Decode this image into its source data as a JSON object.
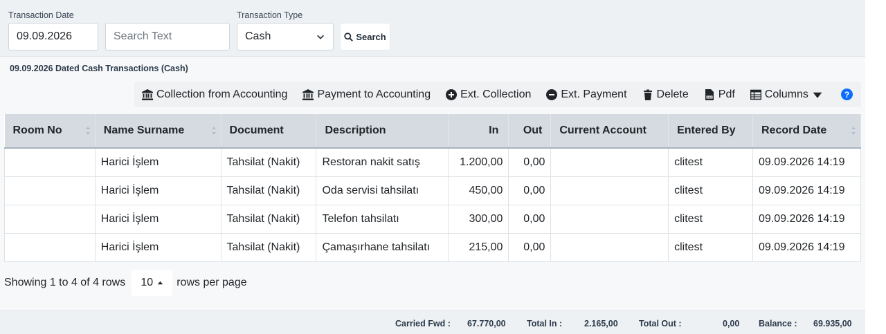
{
  "filters": {
    "date_label": "Transaction Date",
    "date_value": "09.09.2026",
    "search_placeholder": "Search Text",
    "type_label": "Transaction Type",
    "type_value": "Cash",
    "search_button": "Search"
  },
  "section_title": "09.09.2026 Dated Cash Transactions (Cash)",
  "toolbar": {
    "collection_accounting": "Collection from Accounting",
    "payment_accounting": "Payment to Accounting",
    "ext_collection": "Ext. Collection",
    "ext_payment": "Ext. Payment",
    "delete": "Delete",
    "pdf": "Pdf",
    "columns": "Columns",
    "help": "?"
  },
  "table": {
    "headers": [
      "Room No",
      "Name Surname",
      "Document",
      "Description",
      "In",
      "Out",
      "Current Account",
      "Entered By",
      "Record Date"
    ],
    "rows": [
      [
        "",
        "Harici İşlem",
        "Tahsilat (Nakit)",
        "Restoran nakit satış",
        "1.200,00",
        "0,00",
        "",
        "clitest",
        "09.09.2026 14:19"
      ],
      [
        "",
        "Harici İşlem",
        "Tahsilat (Nakit)",
        "Oda servisi tahsilatı",
        "450,00",
        "0,00",
        "",
        "clitest",
        "09.09.2026 14:19"
      ],
      [
        "",
        "Harici İşlem",
        "Tahsilat (Nakit)",
        "Telefon tahsilatı",
        "300,00",
        "0,00",
        "",
        "clitest",
        "09.09.2026 14:19"
      ],
      [
        "",
        "Harici İşlem",
        "Tahsilat (Nakit)",
        "Çamaşırhane tahsilatı",
        "215,00",
        "0,00",
        "",
        "clitest",
        "09.09.2026 14:19"
      ]
    ]
  },
  "pager": {
    "showing": "Showing 1 to 4 of 4 rows",
    "page_size": "10",
    "rows_per_page": "rows per page"
  },
  "footer": {
    "carried_label": "Carried Fwd :",
    "carried_value": "67.770,00",
    "total_in_label": "Total In :",
    "total_in_value": "2.165,00",
    "total_out_label": "Total Out :",
    "total_out_value": "0,00",
    "balance_label": "Balance :",
    "balance_value": "69.935,00"
  },
  "colors": {
    "accent": "#0d6efd",
    "header_bg": "#d6dbe1",
    "filter_bg": "#eef1f4"
  }
}
